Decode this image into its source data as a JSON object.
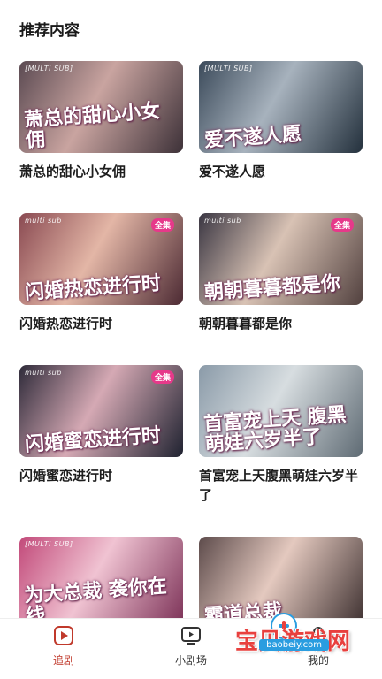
{
  "section": {
    "title": "推荐内容"
  },
  "cards": [
    {
      "name": "萧总的甜心小女佣",
      "thumb_title": "萧总的甜心小女佣",
      "tag": "[MULTI SUB]",
      "badge": "",
      "bg": [
        "#5b4a52",
        "#c9a4a0",
        "#3d3138"
      ]
    },
    {
      "name": "爱不遂人愿",
      "thumb_title": "爱不遂人愿",
      "tag": "[MULTI SUB]",
      "badge": "",
      "bg": [
        "#3b4a5a",
        "#a7b2bd",
        "#24313d"
      ]
    },
    {
      "name": "闪婚热恋进行时",
      "thumb_title": "闪婚热恋进行时",
      "tag": "multi sub",
      "badge": "全集",
      "bg": [
        "#8a4a52",
        "#e3b6a6",
        "#4c2a33"
      ]
    },
    {
      "name": "朝朝暮暮都是你",
      "thumb_title": "朝朝暮暮都是你",
      "tag": "multi sub",
      "badge": "全集",
      "bg": [
        "#3a3642",
        "#d8c2b4",
        "#52413f"
      ]
    },
    {
      "name": "闪婚蜜恋进行时",
      "thumb_title": "闪婚蜜恋进行时",
      "tag": "multi sub",
      "badge": "全集",
      "bg": [
        "#2f2b3a",
        "#d5a9b4",
        "#1f2230"
      ]
    },
    {
      "name": "首富宠上天腹黑萌娃六岁半了",
      "thumb_title": "首富宠上天 腹黑萌娃六岁半了",
      "tag": "",
      "badge": "",
      "bg": [
        "#8a9aa8",
        "#d7dde0",
        "#5f6b74"
      ]
    },
    {
      "name": "",
      "thumb_title": "为大总裁 袭你在线",
      "tag": "[MULTI SUB]",
      "badge": "",
      "bg": [
        "#c24a7a",
        "#f0c3d2",
        "#7a2f55"
      ]
    },
    {
      "name": "",
      "thumb_title": "霸道总裁",
      "tag": "",
      "badge": "",
      "bg": [
        "#5d4b4b",
        "#e4c9bf",
        "#3c2f2f"
      ]
    }
  ],
  "nav": {
    "items": [
      {
        "label": "追剧",
        "icon": "play-circle-icon",
        "active": true
      },
      {
        "label": "小剧场",
        "icon": "video-screen-icon",
        "active": false
      },
      {
        "label": "我的",
        "icon": "profile-icon",
        "active": false
      }
    ]
  },
  "watermark": {
    "text": "宝贝游戏网",
    "url": "baobeiy.com"
  },
  "colors": {
    "accent": "#c0392b",
    "watermark": "#e8403e"
  }
}
